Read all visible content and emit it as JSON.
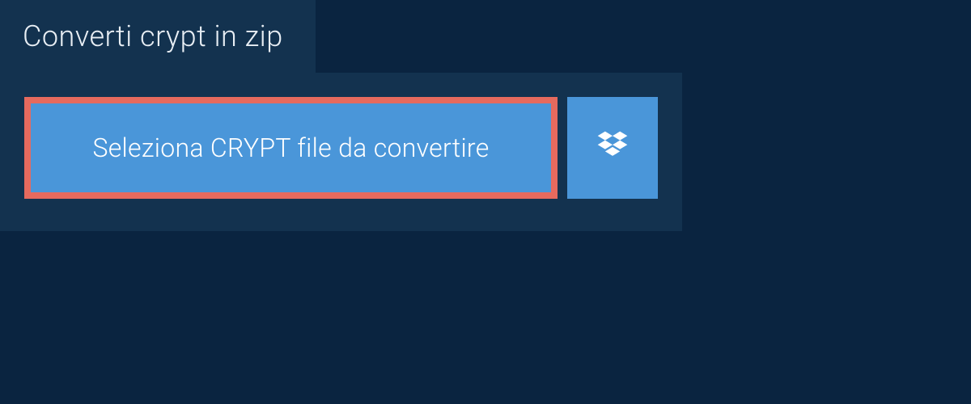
{
  "header": {
    "title": "Converti crypt in zip"
  },
  "actions": {
    "select_file_label": "Seleziona CRYPT file da convertire"
  },
  "colors": {
    "background": "#0a2440",
    "panel": "#13324f",
    "button_primary": "#4a96d9",
    "button_highlight_border": "#e66a5e",
    "text_light": "#e8eef4",
    "text_white": "#ffffff"
  },
  "icons": {
    "dropbox": "dropbox-icon"
  }
}
